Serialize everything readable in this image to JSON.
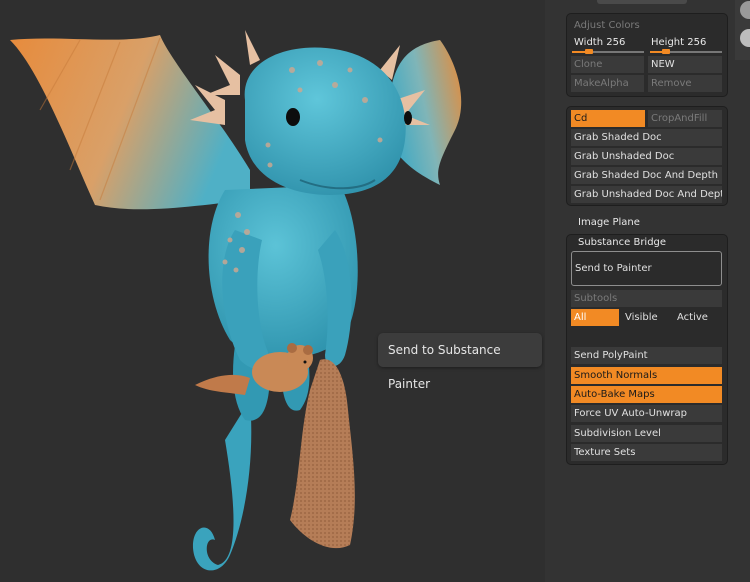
{
  "viewport": {
    "tooltip": "Send to Substance Painter"
  },
  "panel": {
    "adjust_colors": "Adjust Colors",
    "width_label": "Width 256",
    "height_label": "Height 256",
    "width_fraction": 0.25,
    "height_fraction": 0.25,
    "clone": "Clone",
    "new": "NEW",
    "make_alpha": "MakeAlpha",
    "remove": "Remove",
    "cd": "Cd",
    "crop_and_fill": "CropAndFill",
    "grab_shaded_doc": "Grab Shaded Doc",
    "grab_unshaded_doc": "Grab Unshaded Doc",
    "grab_shaded_doc_depth": "Grab Shaded Doc And Depth",
    "grab_unshaded_doc_depth": "Grab Unshaded Doc And Depth",
    "image_plane": "Image Plane",
    "substance_bridge": "Substance Bridge",
    "send_to_painter": "Send to Painter",
    "subtools": "Subtools",
    "all": "All",
    "visible": "Visible",
    "active": "Active",
    "send_polypaint": "Send PolyPaint",
    "smooth_normals": "Smooth Normals",
    "auto_bake_maps": "Auto-Bake Maps",
    "force_uv": "Force UV Auto-Unwrap",
    "subdivision_level": "Subdivision Level",
    "texture_sets": "Texture Sets"
  },
  "colors": {
    "accent": "#f28a24",
    "panel_bg": "#333333",
    "viewport_bg": "#2f2f2f",
    "creature_body": "#3aa6bf",
    "creature_wing": "#e0904a"
  }
}
